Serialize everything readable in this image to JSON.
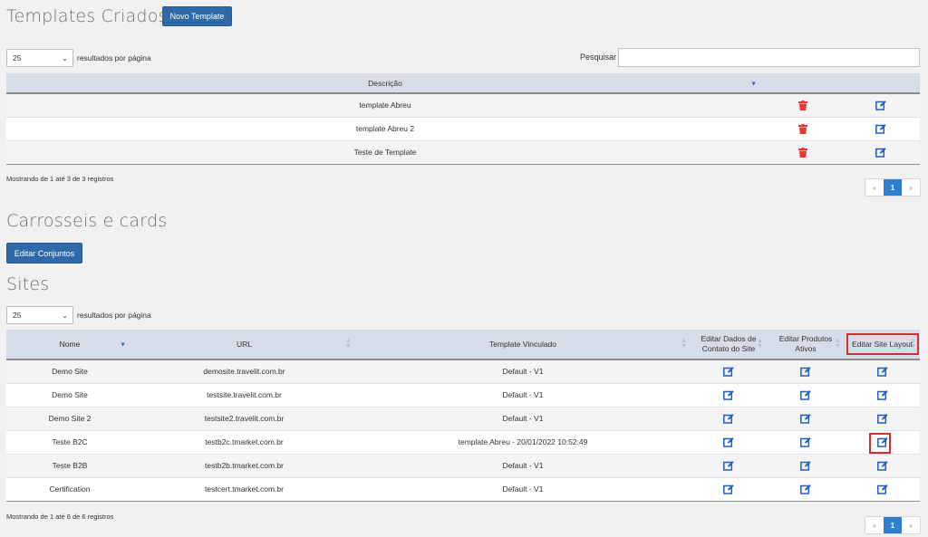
{
  "templates": {
    "title": "Templates Criados",
    "new_button": "Novo Template",
    "page_size": "25",
    "page_size_label": "resultados por página",
    "search_label": "Pesquisar",
    "search_value": "",
    "header_descricao": "Descrição",
    "rows": [
      {
        "descricao": "template Abreu"
      },
      {
        "descricao": "template Abreu 2"
      },
      {
        "descricao": "Teste de Template"
      }
    ],
    "info": "Mostrando de 1 até 3 de 3 registros",
    "pager": {
      "prev": "«",
      "current": "1",
      "next": "»"
    }
  },
  "carrosseis": {
    "title": "Carrosseis e cards",
    "edit_button": "Editar Conjuntos"
  },
  "sites": {
    "title": "Sites",
    "page_size": "25",
    "page_size_label": "resultados por página",
    "headers": {
      "nome": "Nome",
      "url": "URL",
      "template": "Template Vinculado",
      "editar_dados_1": "Editar Dados de",
      "editar_dados_2": "Contato do Site",
      "editar_produtos_1": "Editar Produtos",
      "editar_produtos_2": "Ativos",
      "editar_layout": "Editar Site Layout"
    },
    "rows": [
      {
        "nome": "Demo Site",
        "url": "demosite.travelit.com.br",
        "template": "Default - V1"
      },
      {
        "nome": "Demo Site",
        "url": "testsite.travelit.com.br",
        "template": "Default - V1"
      },
      {
        "nome": "Demo Site 2",
        "url": "testsite2.travelit.com.br",
        "template": "Default - V1"
      },
      {
        "nome": "Teste B2C",
        "url": "testb2c.tmarket.com.br",
        "template": "template Abreu - 20/01/2022 10:52:49"
      },
      {
        "nome": "Teste B2B",
        "url": "testb2b.tmarket.com.br",
        "template": "Default - V1"
      },
      {
        "nome": "Certification",
        "url": "testcert.tmarket.com.br",
        "template": "Default - V1"
      }
    ],
    "info": "Mostrando de 1 até 6 de 6 registros",
    "pager": {
      "prev": "«",
      "current": "1",
      "next": "»"
    }
  },
  "icons": {
    "delete": "trash-icon",
    "edit": "edit-icon",
    "sort_desc": "sort-desc-icon",
    "sort_both": "sort-both-icon",
    "select_chevron": "chevron-down-icon"
  },
  "colors": {
    "primary": "#2f6aa8",
    "header_bg": "#d6dde8",
    "trash": "#e53935",
    "edit": "#1e5fbf",
    "highlight": "#d32f2f",
    "pager_active": "#2f7fd1"
  }
}
